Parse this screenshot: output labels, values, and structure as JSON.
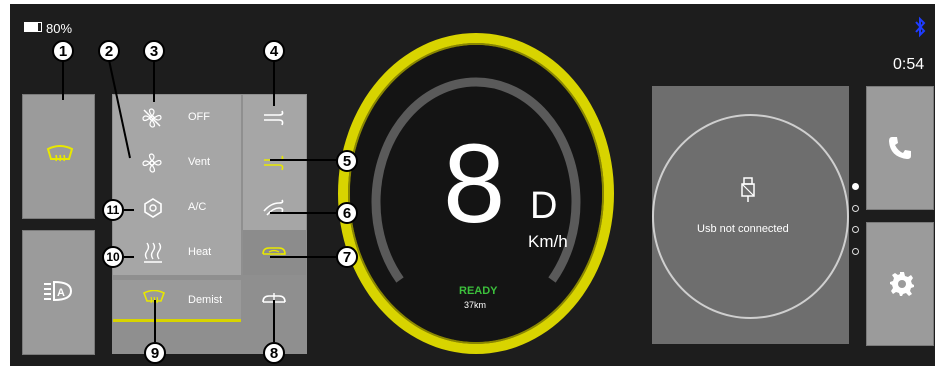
{
  "status": {
    "battery_percent": "80%",
    "battery_level": 0.8,
    "time": "0:54"
  },
  "climate": {
    "fan_off": "OFF",
    "vent": "Vent",
    "ac": "A/C",
    "heat": "Heat",
    "demist": "Demist"
  },
  "speedometer": {
    "speed": "8",
    "gear": "D",
    "unit": "Km/h",
    "ready": "READY",
    "range": "37km"
  },
  "media": {
    "usb_status": "Usb not connected"
  },
  "callouts": [
    "1",
    "2",
    "3",
    "4",
    "5",
    "6",
    "7",
    "8",
    "9",
    "10",
    "11"
  ],
  "colors": {
    "accent": "#d8d400",
    "ready_green": "#3cbf3c",
    "bluetooth": "#1e3cff",
    "panel": "#1d1d1d",
    "button": "#9b9b9b"
  },
  "icons": [
    "battery-icon",
    "bluetooth-icon",
    "rear-defrost-icon",
    "auto-headlight-icon",
    "fan-off-icon",
    "fan-icon",
    "ac-icon",
    "heat-icon",
    "demist-icon",
    "airflow-face-icon",
    "airflow-face-feet-icon",
    "airflow-feet-icon",
    "recirculation-icon",
    "fresh-air-icon",
    "usb-icon",
    "phone-icon",
    "gear-icon"
  ]
}
